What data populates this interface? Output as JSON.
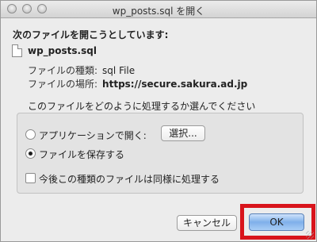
{
  "window": {
    "title": "wp_posts.sql を開く"
  },
  "dialog": {
    "heading": "次のファイルを開こうとしています:",
    "file_icon": "document-icon",
    "filename": "wp_posts.sql",
    "type_label": "ファイルの種類:",
    "type_value": "sql File",
    "location_label": "ファイルの場所:",
    "location_value": "https://secure.sakura.ad.jp",
    "question": "このファイルをどのように処理するか選んでください",
    "options": {
      "open_with_label": "アプリケーションで開く:",
      "choose_button": "選択...",
      "save_label": "ファイルを保存する",
      "selected": "save"
    },
    "remember_label": "今後この種類のファイルは同様に処理する",
    "remember_checked": false
  },
  "buttons": {
    "cancel": "キャンセル",
    "ok": "OK"
  },
  "colors": {
    "highlight": "#d8141b",
    "default_button": "#7fb0ea"
  }
}
